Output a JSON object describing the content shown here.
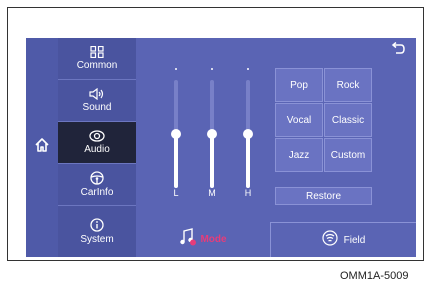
{
  "menu": {
    "items": [
      {
        "label": "Common",
        "icon": "grid-icon",
        "active": false
      },
      {
        "label": "Sound",
        "icon": "speaker-icon",
        "active": false
      },
      {
        "label": "Audio",
        "icon": "audio-icon",
        "active": true
      },
      {
        "label": "CarInfo",
        "icon": "steering-wheel-icon",
        "active": false
      },
      {
        "label": "System",
        "icon": "info-icon",
        "active": false
      }
    ]
  },
  "equalizer": {
    "bands": [
      {
        "label": "L",
        "level": 0.5
      },
      {
        "label": "M",
        "level": 0.5
      },
      {
        "label": "H",
        "level": 0.5
      }
    ]
  },
  "presets": [
    "Pop",
    "Rock",
    "Vocal",
    "Classic",
    "Jazz",
    "Custom"
  ],
  "restore_label": "Restore",
  "mode_label": "Mode",
  "field_label": "Field",
  "caption": "OMM1A-5009",
  "colors": {
    "background": "#5a64b4",
    "active": "#20243a",
    "mode": "#e63c7a"
  }
}
